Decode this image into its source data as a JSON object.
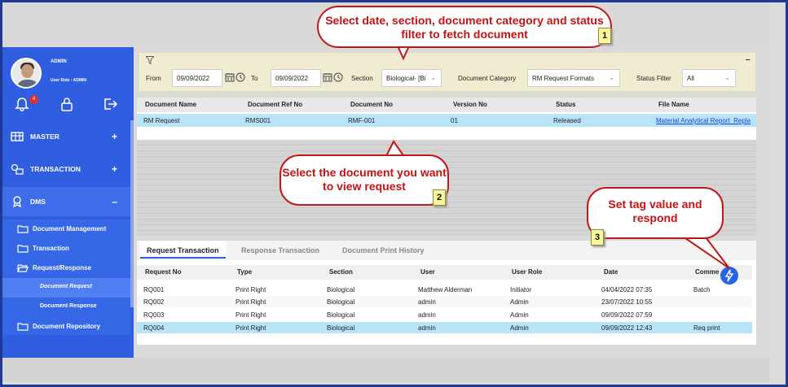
{
  "user": {
    "name": "ADMIN",
    "role": "User Role : ADMIN",
    "notification_count": "4"
  },
  "sidebar": {
    "menu": [
      {
        "label": "MASTER",
        "sign": "+"
      },
      {
        "label": "TRANSACTION",
        "sign": "+"
      },
      {
        "label": "DMS",
        "sign": "–"
      }
    ],
    "submenu": [
      {
        "label": "Document Management"
      },
      {
        "label": "Transaction"
      },
      {
        "label": "Request/Response"
      },
      {
        "label": "Document Request"
      },
      {
        "label": "Document Response"
      },
      {
        "label": "Document Repository"
      }
    ]
  },
  "filter": {
    "from_label": "From",
    "from_value": "09/09/2022",
    "to_label": "To",
    "to_value": "09/09/2022",
    "section_label": "Section",
    "section_value": "Biological- [Bi",
    "category_label": "Document Category",
    "category_value": "RM Request Formats",
    "status_label": "Status Filter",
    "status_value": "All",
    "collapse": "–"
  },
  "documents": {
    "columns": [
      "Document Name",
      "Document Ref No",
      "Document No",
      "Version No",
      "Status",
      "File Name"
    ],
    "rows": [
      [
        "RM Request",
        "RMS001",
        "RMF-001",
        "01",
        "Released",
        "Material Analytical Report_Repla"
      ]
    ]
  },
  "tabs": [
    "Request Transaction",
    "Response Transaction",
    "Document Print History"
  ],
  "requests": {
    "columns": [
      "Request No",
      "Type",
      "Section",
      "User",
      "User Role",
      "Date",
      "Comme"
    ],
    "rows": [
      [
        "RQ001",
        "Print Right",
        "Biological",
        "Matthew Alderman",
        "Initiator",
        "04/04/2022 07:35",
        "Batch"
      ],
      [
        "RQ002",
        "Print Right",
        "Biological",
        "admin",
        "Admin",
        "23/07/2022 10:55",
        ""
      ],
      [
        "RQ003",
        "Print Right",
        "Biological",
        "admin",
        "Admin",
        "09/09/2022 07:59",
        ""
      ],
      [
        "RQ004",
        "Print Right",
        "Biological",
        "admin",
        "Admin",
        "09/09/2022 12:43",
        "Req print"
      ]
    ]
  },
  "callouts": [
    {
      "text": "Select date, section, document category and status filter to fetch document",
      "number": "1"
    },
    {
      "text": "Select the document you want to view request",
      "number": "2"
    },
    {
      "text": "Set  tag value and respond",
      "number": "3"
    }
  ],
  "colors": {
    "sidebar": "#2f5fe0",
    "selected_row": "#b9e4f7",
    "callout_red": "#c41212"
  }
}
